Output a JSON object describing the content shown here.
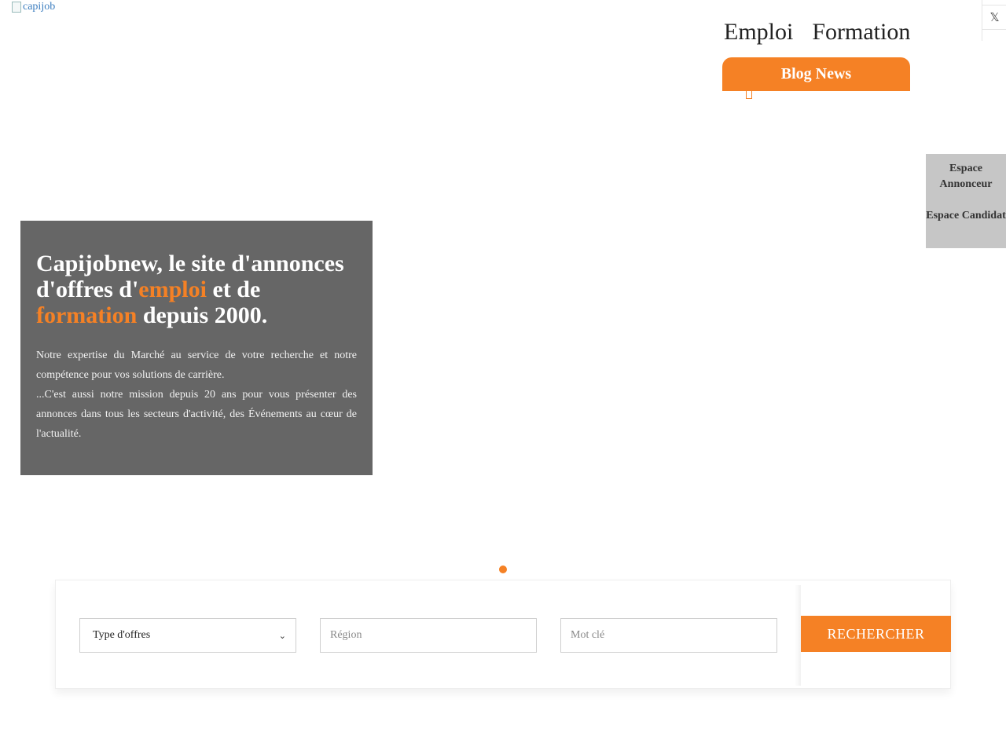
{
  "header": {
    "logo_alt": "capijob",
    "nav": [
      "Emploi",
      "Formation"
    ],
    "blog_label": "Blog News",
    "social_icon": "x-icon",
    "social_glyph": "𝕏"
  },
  "side_menu": {
    "annonceur": "Espace Annonceur",
    "candidat": "Espace Candidat"
  },
  "hero": {
    "title_part1": "Capijobnew, le site d'annonces d'offres d'",
    "title_accent1": "emploi",
    "title_part2": " et de ",
    "title_accent2": "formation",
    "title_part3": " depuis 2000.",
    "paragraph1": "Notre expertise du Marché au service de votre recherche et notre compétence pour vos solutions de carrière.",
    "paragraph2": "...C'est aussi notre mission depuis 20 ans pour vous présenter des annonces dans tous les secteurs d'activité, des Événements au cœur de l'actualité."
  },
  "carousel": {
    "active_slide": 1,
    "slide_count": 1
  },
  "search": {
    "type_select_value": "Type d'offres",
    "region_placeholder": "Région",
    "keyword_placeholder": "Mot clé",
    "button_label": "RECHERCHER"
  },
  "colors": {
    "accent": "#f58125",
    "hero_bg": "#666666",
    "side_menu_bg": "#c6c6c6"
  }
}
